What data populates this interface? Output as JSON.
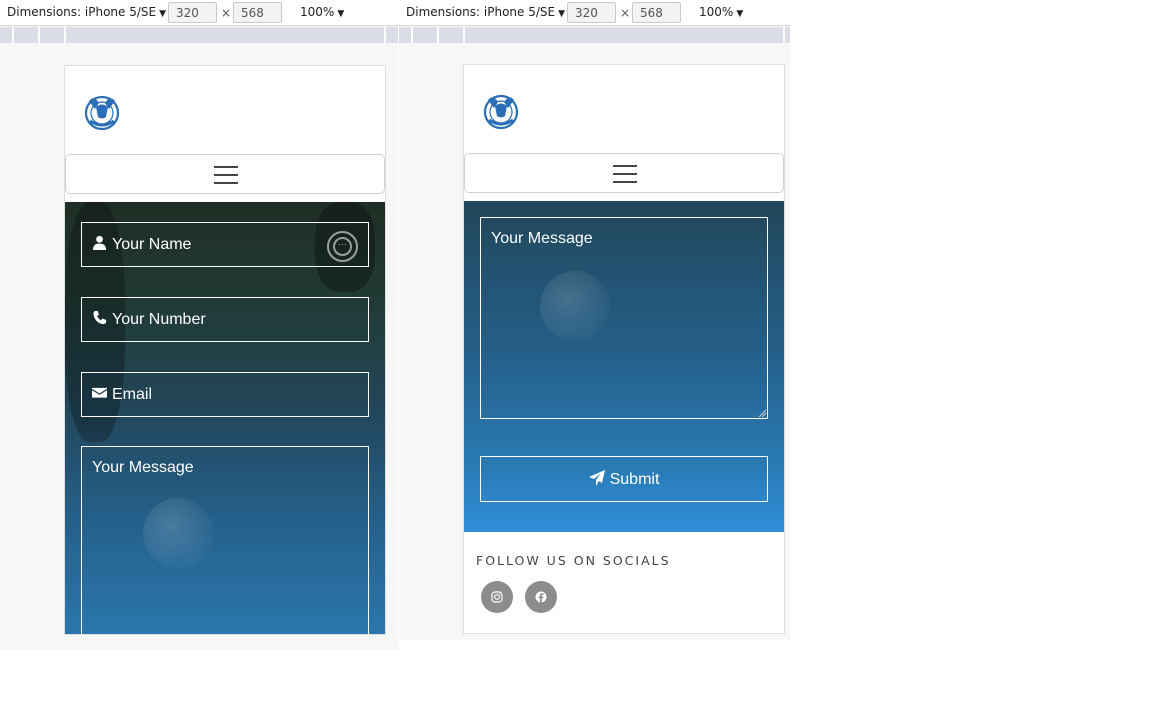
{
  "devtools": {
    "dimensions_label": "Dimensions: iPhone 5/SE",
    "width_value": "320",
    "height_value": "568",
    "times": "×",
    "zoom_label": "100%"
  },
  "icons": {
    "logo": "team-crest-logo",
    "menu": "hamburger-menu-icon",
    "name": "user-icon",
    "number": "phone-icon",
    "email": "envelope-icon",
    "submit": "paper-plane-icon",
    "instagram": "instagram-icon",
    "facebook": "facebook-icon"
  },
  "colors": {
    "accent": "#2b8cd6",
    "hero_top": "#1f2e25",
    "hero_bottom": "#2a77ad",
    "social_bg": "#8c8c8c"
  },
  "form": {
    "name_placeholder": "Your Name",
    "number_placeholder": "Your Number",
    "email_placeholder": "Email",
    "message_placeholder": "Your Message",
    "submit_label": "Submit"
  },
  "footer": {
    "follow_heading": "FOLLOW US ON SOCIALS"
  }
}
